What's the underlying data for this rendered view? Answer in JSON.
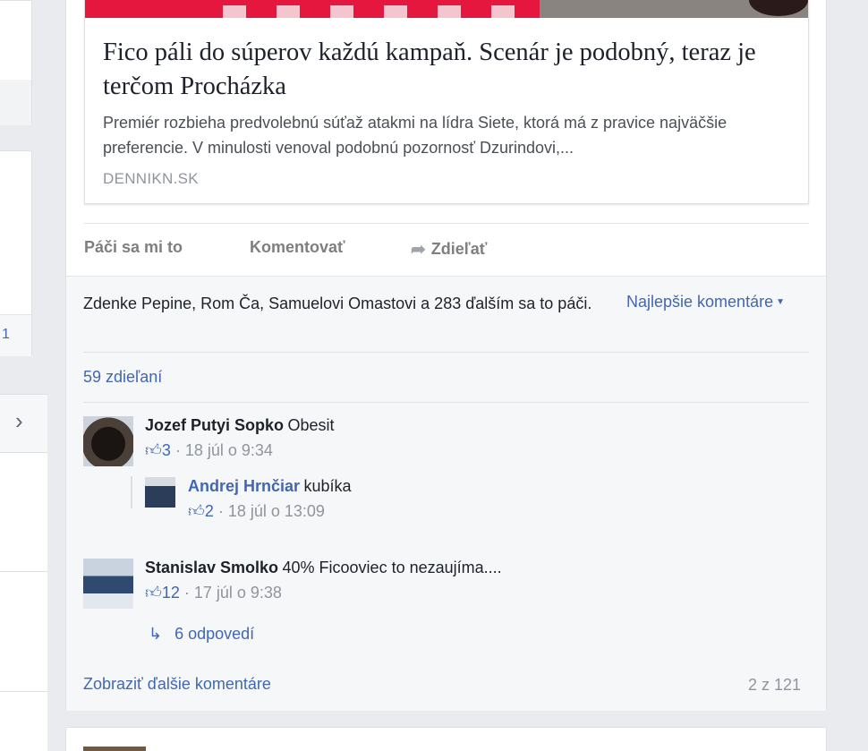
{
  "link_preview": {
    "title": "Fico páli do súperov každú kampaň. Scenár je podobný, teraz je terčom Procházka",
    "description": "Premiér rozbieha predvolebnú súťaž atakmi na lídra Siete, ktorá má z pravice najväčšie preferencie. V minulosti venoval podobnú pozornosť Dzurindovi,...",
    "domain": "DENNIKN.SK"
  },
  "actions": {
    "like": "Páči sa mi to",
    "comment": "Komentovať",
    "share": "Zdieľať"
  },
  "ufi": {
    "likes_text": "Zdenke Pepine, Rom Ča, Samuelovi Omastovi a 283 ďalším sa to páči.",
    "best_comments": "Najlepšie komentáre",
    "shares": "59 zdieľaní",
    "more_comments": "Zobraziť ďalšie komentáre",
    "count": "2 z 121"
  },
  "comments": [
    {
      "author": "Jozef Putyi Sopko",
      "text": "Obesit",
      "likes": "3",
      "time": "18 júl o 9:34"
    },
    {
      "author": "Andrej Hrnčiar",
      "text": "kubíka",
      "likes": "2",
      "time": "18 júl o 13:09"
    },
    {
      "author": "Stanislav Smolko",
      "text": "40% Ficooviec to nezaujíma....",
      "likes": "12",
      "time": "17 júl o 9:38",
      "replies": "6 odpovedí"
    }
  ],
  "left_col": {
    "number": "1"
  },
  "icons": {
    "thumb": "thumbs-up-icon",
    "share": "share-arrow-icon",
    "chevron": "chevron-right-icon",
    "reply": "reply-arrow-icon"
  },
  "colors": {
    "link": "#4267b2",
    "meta": "#90949c",
    "background": "#e9ebee"
  }
}
